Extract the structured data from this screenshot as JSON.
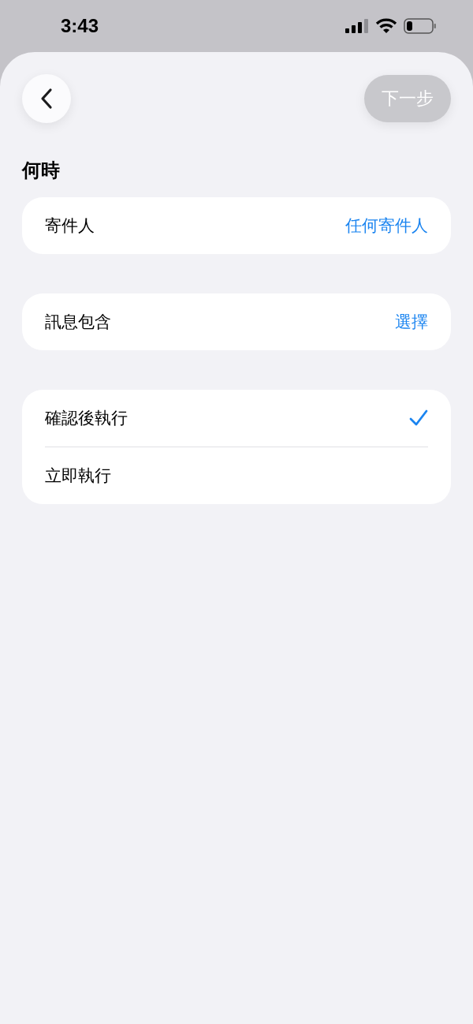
{
  "status_bar": {
    "time": "3:43"
  },
  "next_button": {
    "label": "下一步",
    "disabled": true
  },
  "section_title": "何時",
  "conditions": [
    {
      "label": "寄件人",
      "value": "任何寄件人"
    },
    {
      "label": "訊息包含",
      "value": "選擇"
    }
  ],
  "run_options": [
    {
      "label": "確認後執行",
      "selected": true
    },
    {
      "label": "立即執行",
      "selected": false
    }
  ]
}
